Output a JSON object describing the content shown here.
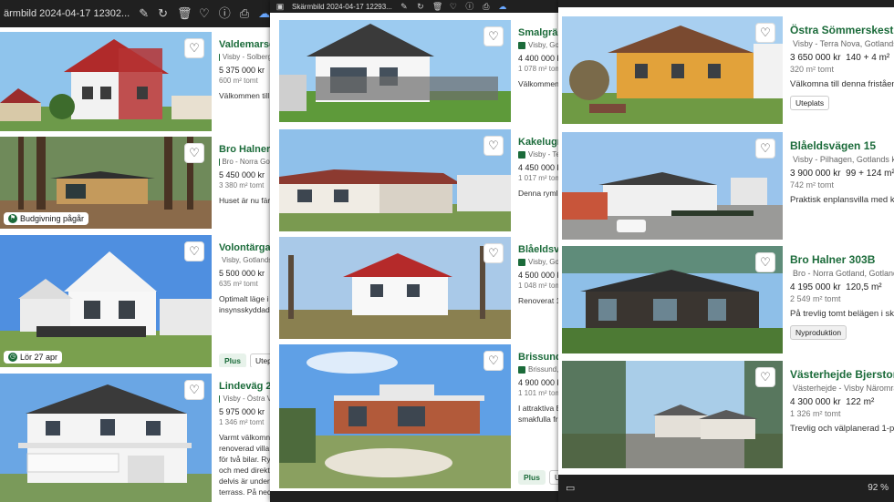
{
  "window1": {
    "title": "ärmbild 2024-04-17 12302...",
    "listings": [
      {
        "street": "Valdemarsgata",
        "location": "Visby - Solberg",
        "price": "5 375 000 kr",
        "meta": "600 m² tomt",
        "desc": [
          "Välkommen till e"
        ],
        "badge": "",
        "chips": []
      },
      {
        "street": "Bro Halner 30",
        "location": "Bro - Norra Got",
        "price": "5 450 000 kr",
        "meta": "3 380 m² tomt",
        "desc": [
          "Huset är nu färd"
        ],
        "badge": "Budgivning pågår",
        "chips": []
      },
      {
        "street": "Volontärgatan",
        "location": "Visby, Gotlands",
        "price": "5 500 000 kr",
        "meta": "635 m² tomt",
        "desc": [
          "Optimalt läge i y",
          "insynsskyddad b"
        ],
        "badge": "Lör 27 apr",
        "chips": [
          "Plus",
          "Uteplats"
        ]
      },
      {
        "street": "Lindeväg 23",
        "location": "Visby - Östra V",
        "price": "5 975 000 kr",
        "meta": "1 346 m² tomt",
        "desc": [
          "Varmt välkomna",
          "renoverad villa n",
          "för två bilar. Ry",
          "och med direkta",
          "delvis är under t",
          "terrass. På nede"
        ],
        "badge": "",
        "chips": []
      }
    ]
  },
  "window2": {
    "title": "Skärmbild 2024-04-17 12293...",
    "listings": [
      {
        "street": "Smalgränd",
        "location": "Visby, Got",
        "price": "4 400 000 k",
        "meta": "1 078 m² tom",
        "desc": [
          "Välkommen"
        ],
        "chips": []
      },
      {
        "street": "Kakelugns",
        "location": "Visby - Te",
        "price": "4 450 000 k",
        "meta": "1 017 m² tom",
        "desc": [
          "Denna rymli"
        ],
        "chips": []
      },
      {
        "street": "Blåeldsväg",
        "location": "Visby, Got",
        "price": "4 500 000 k",
        "meta": "1 048 m² tom",
        "desc": [
          "Renoverat 1"
        ],
        "chips": []
      },
      {
        "street": "Brissund B",
        "location": "Brissund,",
        "price": "4 900 000 k",
        "meta": "1 101 m² tom",
        "desc": [
          "I attraktiva B",
          "smakfulla fr"
        ],
        "chips": [
          "Plus",
          "Ute"
        ]
      }
    ]
  },
  "window3": {
    "zoom": "92 %",
    "listings": [
      {
        "street": "Östra Sömmerskestigen",
        "location": "Visby - Terra Nova, Gotlands",
        "price": "3 650 000 kr",
        "size": "140 + 4 m²",
        "meta": "320 m² tomt",
        "desc": [
          "Välkomna till denna fristående"
        ],
        "chips": [
          "Uteplats"
        ]
      },
      {
        "street": "Blåeldsvägen 15",
        "location": "Visby - Pilhagen, Gotlands ko",
        "price": "3 900 000 kr",
        "size": "99 + 124 m²",
        "meta": "742 m² tomt",
        "desc": [
          "Praktisk enplansvilla med kä"
        ],
        "chips": []
      },
      {
        "street": "Bro Halner 303B",
        "location": "Bro - Norra Gotland, Gotlands",
        "price": "4 195 000 kr",
        "size": "120,5 m²",
        "meta": "2 549 m² tomt",
        "desc": [
          "På trevlig tomt belägen i sko"
        ],
        "chips": [
          "Nyproduktion"
        ]
      },
      {
        "street": "Västerhejde Bjerstorpsvä",
        "location": "Västerhejde - Visby Närområ",
        "price": "4 300 000 kr",
        "size": "122 m²",
        "meta": "1 326 m² tomt",
        "desc": [
          "Trevlig och välplanerad 1-pla"
        ],
        "chips": []
      }
    ]
  },
  "icons": [
    "image-icon",
    "edit-icon",
    "rotate-icon",
    "trash-icon",
    "heart-icon",
    "info-icon",
    "print-icon",
    "cloud-icon",
    "more-icon"
  ],
  "colors": {
    "accent": "#1b6b3a",
    "titlebar": "#202020"
  }
}
